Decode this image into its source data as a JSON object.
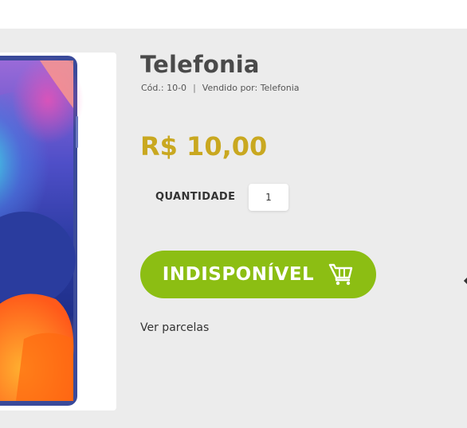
{
  "product": {
    "name": "Telefonia",
    "code_label": "Cód.: 10-0",
    "separator": "|",
    "seller_label": "Vendido por:",
    "seller_name": "Telefonia",
    "price": "R$ 10,00"
  },
  "quantity": {
    "label": "QUANTIDADE",
    "value": "1"
  },
  "buy_button": {
    "label": "INDISPONÍVEL",
    "icon": "cart-icon"
  },
  "installments_link": "Ver parcelas",
  "colors": {
    "accent_green": "#8cbe13",
    "price_gold": "#c9a820",
    "panel_background": "#ececec"
  }
}
